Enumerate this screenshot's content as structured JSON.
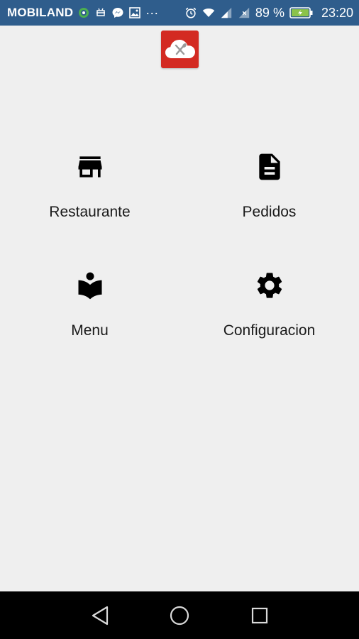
{
  "status_bar": {
    "carrier": "MOBILAND",
    "battery_percent": "89 %",
    "time": "23:20",
    "background_color": "#2f5d8c",
    "icons_left": [
      "globe-badge-icon",
      "android-debug-icon",
      "messenger-icon",
      "image-icon",
      "more-dots-icon"
    ],
    "icons_right": [
      "alarm-icon",
      "wifi-icon",
      "signal-icon",
      "no-sim-icon",
      "battery-charging-icon"
    ],
    "more_dots": "···"
  },
  "app": {
    "logo_icon": "cloud-cutlery-icon",
    "logo_color": "#d32a22"
  },
  "menu": {
    "items": [
      {
        "label": "Restaurante",
        "icon": "store-icon"
      },
      {
        "label": "Pedidos",
        "icon": "document-icon"
      },
      {
        "label": "Menu",
        "icon": "reading-book-icon"
      },
      {
        "label": "Configuracion",
        "icon": "gear-icon"
      }
    ]
  },
  "nav_bar": {
    "buttons": [
      "back-icon",
      "home-icon",
      "recents-icon"
    ]
  }
}
